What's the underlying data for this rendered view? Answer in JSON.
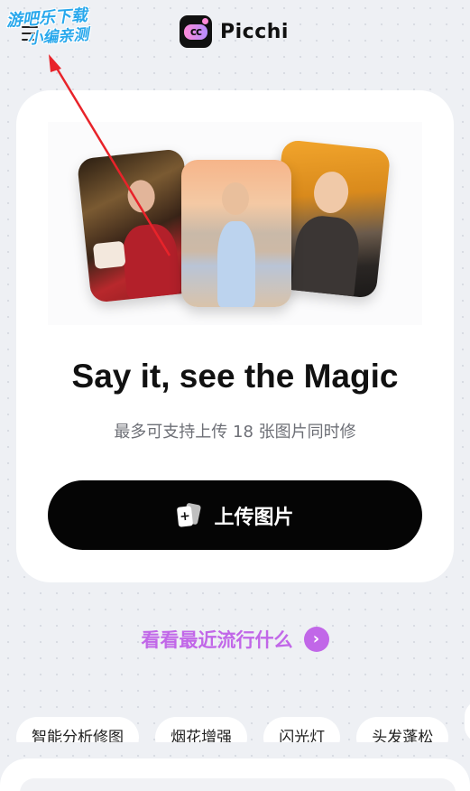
{
  "header": {
    "app_name": "Picchi",
    "logo_mark_text": "cc",
    "watermark_line1": "游吧乐下载",
    "watermark_line2": "小编亲测"
  },
  "hero": {
    "title": "Say it, see the Magic",
    "subtitle": "最多可支持上传 18 张图片同时修",
    "upload_label": "上传图片",
    "upload_icon_glyph": "+"
  },
  "trend": {
    "label": "看看最近流行什么",
    "arrow_glyph": "›"
  },
  "tags": [
    {
      "label": "智能分析修图"
    },
    {
      "label": "烟花增强"
    },
    {
      "label": "闪光灯"
    },
    {
      "label": "头发蓬松"
    },
    {
      "label": ""
    }
  ],
  "colors": {
    "accent": "#c167e8",
    "primary_button": "#050505",
    "background": "#eef0f4",
    "watermark": "#29a8ec",
    "annotation_arrow": "#e8232a"
  },
  "icons": {
    "menu": "menu-icon",
    "logo": "app-logo-icon",
    "upload": "upload-images-icon",
    "chevron": "chevron-right-icon"
  }
}
